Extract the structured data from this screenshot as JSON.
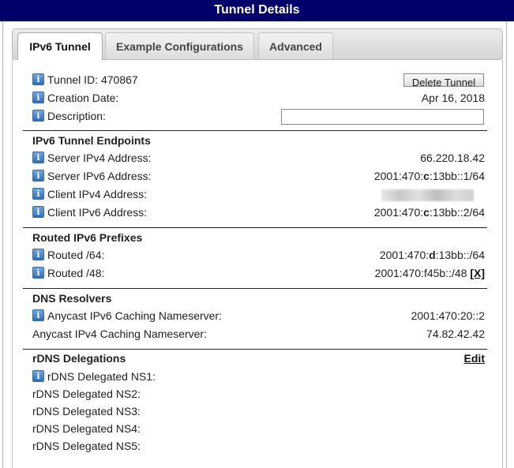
{
  "window": {
    "title": "Tunnel Details"
  },
  "tabs": [
    {
      "label": "IPv6 Tunnel"
    },
    {
      "label": "Example Configurations"
    },
    {
      "label": "Advanced"
    }
  ],
  "tunnel": {
    "id_label": "Tunnel ID:",
    "id_value": "470867",
    "delete_button": "Delete Tunnel",
    "created_label": "Creation Date:",
    "created_value": "Apr 16, 2018",
    "description_label": "Description:",
    "description_value": ""
  },
  "endpoints": {
    "heading": "IPv6 Tunnel Endpoints",
    "server_ipv4_label": "Server IPv4 Address:",
    "server_ipv4_value": "66.220.18.42",
    "server_ipv6_label": "Server IPv6 Address:",
    "server_ipv6_pre": "2001:470:",
    "server_ipv6_bold": "c",
    "server_ipv6_post": ":13bb::1/64",
    "client_ipv4_label": "Client IPv4 Address:",
    "client_ipv6_label": "Client IPv6 Address:",
    "client_ipv6_pre": "2001:470:",
    "client_ipv6_bold": "c",
    "client_ipv6_post": ":13bb::2/64"
  },
  "routed": {
    "heading": "Routed IPv6 Prefixes",
    "r64_label": "Routed /64:",
    "r64_pre": "2001:470:",
    "r64_bold": "d",
    "r64_post": ":13bb::/64",
    "r48_label": "Routed /48:",
    "r48_value": "2001:470:f45b::/48",
    "r48_remove": "[X]"
  },
  "dns": {
    "heading": "DNS Resolvers",
    "anycast_v6_label": "Anycast IPv6 Caching Nameserver:",
    "anycast_v6_value": "2001:470:20::2",
    "anycast_v4_label": "Anycast IPv4 Caching Nameserver:",
    "anycast_v4_value": "74.82.42.42"
  },
  "rdns": {
    "heading": "rDNS Delegations",
    "edit_link": "Edit",
    "ns1": "rDNS Delegated NS1:",
    "ns2": "rDNS Delegated NS2:",
    "ns3": "rDNS Delegated NS3:",
    "ns4": "rDNS Delegated NS4:",
    "ns5": "rDNS Delegated NS5:"
  },
  "icons": {
    "info": "info-icon",
    "info_glyph": "i"
  },
  "colors": {
    "titlebar": "#00006b",
    "info_icon": "#2f6fb8"
  }
}
